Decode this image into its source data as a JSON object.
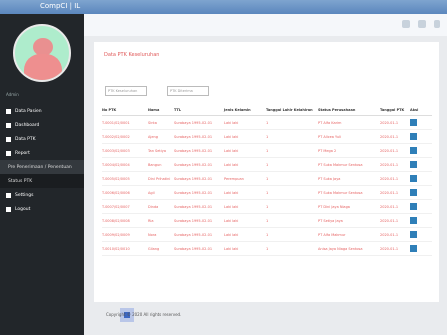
{
  "app": {
    "brand": "CompCI | IL"
  },
  "user": {
    "role": "Admin"
  },
  "nav": {
    "items": [
      {
        "label": "Data Pasien",
        "icon": "home-icon"
      },
      {
        "label": "Dashboard",
        "icon": "dashboard-icon"
      },
      {
        "label": "Data PTK",
        "icon": "table-icon"
      },
      {
        "label": "Report",
        "icon": "report-icon"
      }
    ],
    "sub": [
      {
        "label": "Pre Penerimaan / Penentuan"
      },
      {
        "label": "Status PTK"
      }
    ],
    "bottom": [
      {
        "label": "Settings",
        "icon": "gear-icon"
      },
      {
        "label": "Logout",
        "icon": "logout-icon"
      }
    ]
  },
  "page": {
    "title": "Data PTK Keseluruhan",
    "filter1_placeholder": "PTK Keseluruhan",
    "filter2_placeholder": "PTK Diterima"
  },
  "table": {
    "headers": [
      "No PTK",
      "Nama",
      "TTL",
      "Jenis Kelamin",
      "Tanggal Lahir Kelahiran",
      "Status Perusahaan",
      "Tanggal PTK",
      "Aksi"
    ],
    "rows": [
      [
        "T-0001/02/0001",
        "Sinta",
        "Surabaya 1995-02-01",
        "Laki laki",
        "1",
        "PT Alfa Karim",
        "2020-01-1",
        "edit"
      ],
      [
        "T-0002/02/0002",
        "Ajeng",
        "Surabaya 1995-02-01",
        "Laki laki",
        "1",
        "PT Alicea Yuli",
        "2020-01-1",
        "edit"
      ],
      [
        "T-0003/02/0003",
        "Tan Setiya",
        "Surabaya 1995-02-01",
        "Laki laki",
        "1",
        "PT Mega 2",
        "2020-01-1",
        "edit"
      ],
      [
        "T-0004/02/0004",
        "Bangun",
        "Surabaya 1995-02-01",
        "Laki laki",
        "1",
        "PT Suka Makmur Sentosa",
        "2020-01-1",
        "edit"
      ],
      [
        "T-0005/02/0005",
        "Dini Prihatini",
        "Surabaya 1995-02-01",
        "Perempuan",
        "1",
        "PT Suka Jaya",
        "2020-01-1",
        "edit"
      ],
      [
        "T-0006/02/0006",
        "Agil",
        "Surabaya 1995-02-01",
        "Laki laki",
        "1",
        "PT Suka Makmur Sentosa",
        "2020-01-1",
        "edit"
      ],
      [
        "T-0007/02/0007",
        "Dinda",
        "Surabaya 1995-02-01",
        "Laki laki",
        "1",
        "PT Dini Jaya Niaga",
        "2020-01-1",
        "edit"
      ],
      [
        "T-0008/02/0008",
        "Ria",
        "Surabaya 1995-02-01",
        "Laki laki",
        "1",
        "PT Setiya Jaya",
        "2020-01-1",
        "edit"
      ],
      [
        "T-0009/02/0009",
        "Nora",
        "Surabaya 1995-02-01",
        "Laki laki",
        "1",
        "PT Alfa Makmur",
        "2020-01-1",
        "edit"
      ],
      [
        "T-0010/02/0010",
        "Gilang",
        "Surabaya 1995-02-01",
        "Laki laki",
        "1",
        "Anisa Jaya Niaga Sentosa",
        "2020-01-1",
        "edit"
      ]
    ]
  },
  "footer": {
    "copyright": "Copyright © 2020 All rights reserved."
  },
  "colors": {
    "sidebar": "#22262a",
    "accent": "#e05a5a",
    "topbar": "#5b87bd"
  }
}
